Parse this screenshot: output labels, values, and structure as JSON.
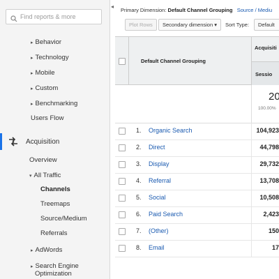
{
  "sidebar": {
    "search_placeholder": "Find reports & more",
    "items": [
      {
        "label": "Behavior",
        "arrow": "▸"
      },
      {
        "label": "Technology",
        "arrow": "▸"
      },
      {
        "label": "Mobile",
        "arrow": "▸"
      },
      {
        "label": "Custom",
        "arrow": "▸"
      },
      {
        "label": "Benchmarking",
        "arrow": "▸"
      },
      {
        "label": "Users Flow"
      },
      {
        "label": "Acquisition"
      },
      {
        "label": "Overview"
      },
      {
        "label": "All Traffic",
        "arrow": "▾"
      },
      {
        "label": "Channels"
      },
      {
        "label": "Treemaps"
      },
      {
        "label": "Source/Medium"
      },
      {
        "label": "Referrals"
      },
      {
        "label": "AdWords",
        "arrow": "▸"
      },
      {
        "label": "Search Engine",
        "arrow": "▸"
      },
      {
        "label": "Optimization"
      }
    ],
    "accent_color": "#1a73e8"
  },
  "collapse_icon": "◂",
  "main": {
    "dimension_label": "Primary Dimension:",
    "dimension_value": "Default Channel Grouping",
    "dimension_alt": "Source / Mediu",
    "plot_rows": "Plot Rows",
    "secondary_dimension": "Secondary dimension",
    "dropdown_arrow": "▾",
    "sort_type_label": "Sort Type:",
    "sort_type_value": "Default"
  },
  "table": {
    "header_dimension": "Default Channel Grouping",
    "header_group": "Acquisiti",
    "header_metric": "Sessio",
    "summary_value": "20",
    "summary_pct": "100.00%",
    "rows": [
      {
        "num": "1.",
        "label": "Organic Search",
        "value": "104,923"
      },
      {
        "num": "2.",
        "label": "Direct",
        "value": "44,798"
      },
      {
        "num": "3.",
        "label": "Display",
        "value": "29,732"
      },
      {
        "num": "4.",
        "label": "Referral",
        "value": "13,708"
      },
      {
        "num": "5.",
        "label": "Social",
        "value": "10,508"
      },
      {
        "num": "6.",
        "label": "Paid Search",
        "value": "2,423"
      },
      {
        "num": "7.",
        "label": "(Other)",
        "value": "150"
      },
      {
        "num": "8.",
        "label": "Email",
        "value": "17"
      }
    ]
  }
}
